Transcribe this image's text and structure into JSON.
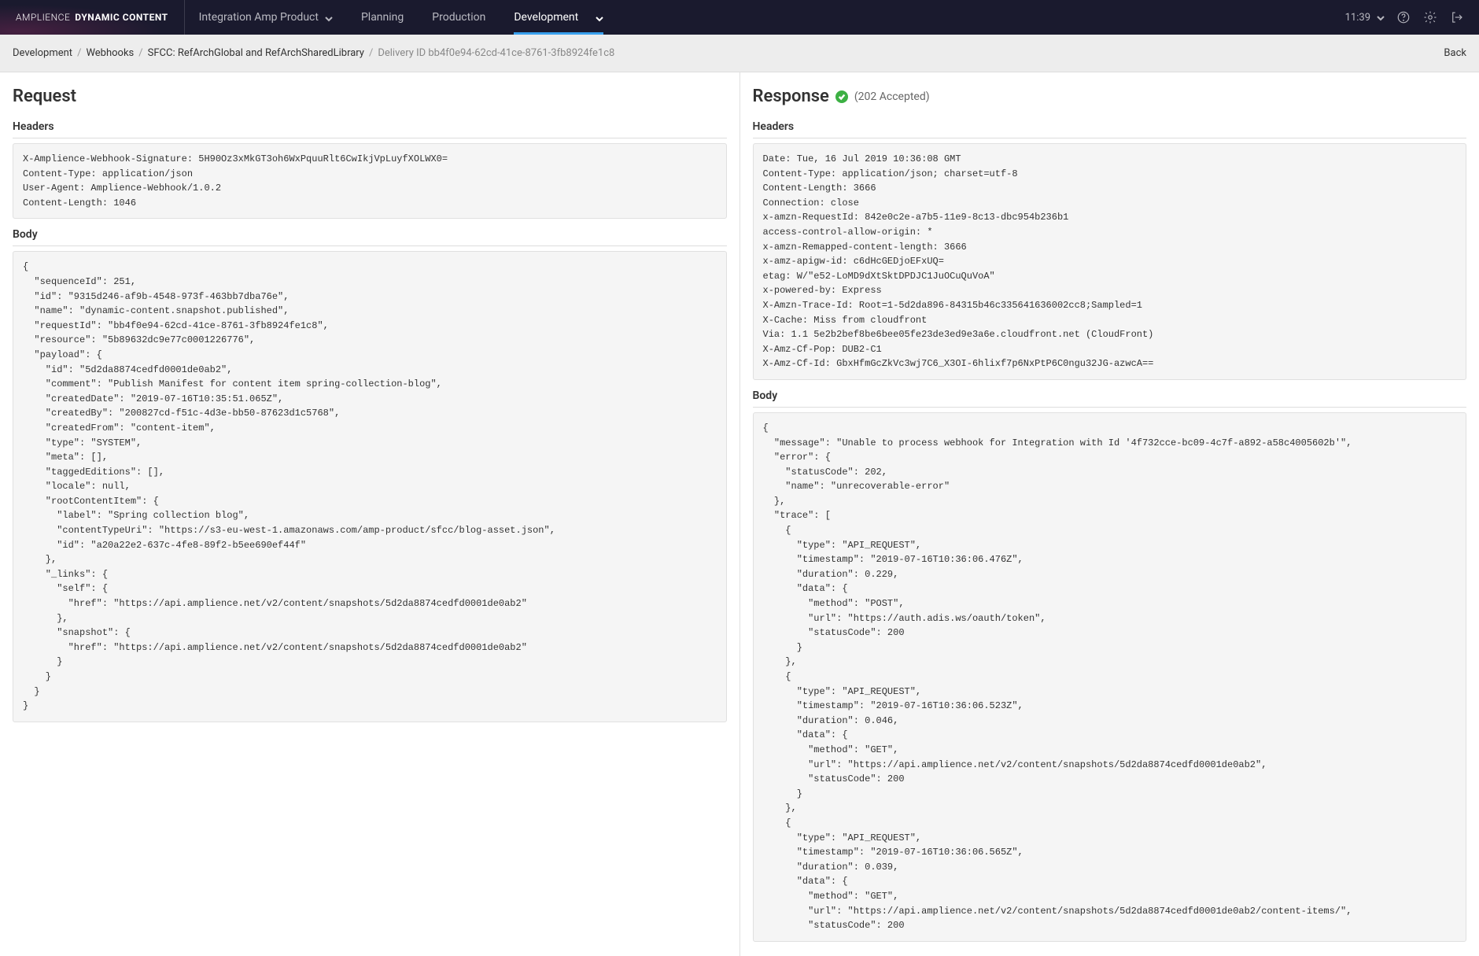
{
  "brand": {
    "part1": "AMPLIENCE",
    "part2": "DYNAMIC CONTENT"
  },
  "nav": {
    "product": "Integration Amp Product",
    "items": [
      "Planning",
      "Production",
      "Development"
    ],
    "active": "Development",
    "time": "11:39"
  },
  "crumbs": {
    "c1": "Development",
    "c2": "Webhooks",
    "c3": "SFCC: RefArchGlobal and RefArchSharedLibrary",
    "c4": "Delivery ID bb4f0e94-62cd-41ce-8761-3fb8924fe1c8",
    "back": "Back"
  },
  "request": {
    "title": "Request",
    "headers_label": "Headers",
    "headers": "X-Amplience-Webhook-Signature: 5H90Oz3xMkGT3oh6WxPquuRlt6CwIkjVpLuyfXOLWX0=\nContent-Type: application/json\nUser-Agent: Amplience-Webhook/1.0.2\nContent-Length: 1046",
    "body_label": "Body",
    "body": "{\n  \"sequenceId\": 251,\n  \"id\": \"9315d246-af9b-4548-973f-463bb7dba76e\",\n  \"name\": \"dynamic-content.snapshot.published\",\n  \"requestId\": \"bb4f0e94-62cd-41ce-8761-3fb8924fe1c8\",\n  \"resource\": \"5b89632dc9e77c0001226776\",\n  \"payload\": {\n    \"id\": \"5d2da8874cedfd0001de0ab2\",\n    \"comment\": \"Publish Manifest for content item spring-collection-blog\",\n    \"createdDate\": \"2019-07-16T10:35:51.065Z\",\n    \"createdBy\": \"200827cd-f51c-4d3e-bb50-87623d1c5768\",\n    \"createdFrom\": \"content-item\",\n    \"type\": \"SYSTEM\",\n    \"meta\": [],\n    \"taggedEditions\": [],\n    \"locale\": null,\n    \"rootContentItem\": {\n      \"label\": \"Spring collection blog\",\n      \"contentTypeUri\": \"https://s3-eu-west-1.amazonaws.com/amp-product/sfcc/blog-asset.json\",\n      \"id\": \"a20a22e2-637c-4fe8-89f2-b5ee690ef44f\"\n    },\n    \"_links\": {\n      \"self\": {\n        \"href\": \"https://api.amplience.net/v2/content/snapshots/5d2da8874cedfd0001de0ab2\"\n      },\n      \"snapshot\": {\n        \"href\": \"https://api.amplience.net/v2/content/snapshots/5d2da8874cedfd0001de0ab2\"\n      }\n    }\n  }\n}"
  },
  "response": {
    "title": "Response",
    "status": "(202 Accepted)",
    "headers_label": "Headers",
    "headers": "Date: Tue, 16 Jul 2019 10:36:08 GMT\nContent-Type: application/json; charset=utf-8\nContent-Length: 3666\nConnection: close\nx-amzn-RequestId: 842e0c2e-a7b5-11e9-8c13-dbc954b236b1\naccess-control-allow-origin: *\nx-amzn-Remapped-content-length: 3666\nx-amz-apigw-id: c6dHcGEDjoEFxUQ=\netag: W/\"e52-LoMD9dXtSktDPDJC1JuOCuQuVoA\"\nx-powered-by: Express\nX-Amzn-Trace-Id: Root=1-5d2da896-84315b46c335641636002cc8;Sampled=1\nX-Cache: Miss from cloudfront\nVia: 1.1 5e2b2bef8be6bee05fe23de3ed9e3a6e.cloudfront.net (CloudFront)\nX-Amz-Cf-Pop: DUB2-C1\nX-Amz-Cf-Id: GbxHfmGcZkVc3wj7C6_X3OI-6hlixf7p6NxPtP6C0ngu32JG-azwcA==",
    "body_label": "Body",
    "body": "{\n  \"message\": \"Unable to process webhook for Integration with Id '4f732cce-bc09-4c7f-a892-a58c4005602b'\",\n  \"error\": {\n    \"statusCode\": 202,\n    \"name\": \"unrecoverable-error\"\n  },\n  \"trace\": [\n    {\n      \"type\": \"API_REQUEST\",\n      \"timestamp\": \"2019-07-16T10:36:06.476Z\",\n      \"duration\": 0.229,\n      \"data\": {\n        \"method\": \"POST\",\n        \"url\": \"https://auth.adis.ws/oauth/token\",\n        \"statusCode\": 200\n      }\n    },\n    {\n      \"type\": \"API_REQUEST\",\n      \"timestamp\": \"2019-07-16T10:36:06.523Z\",\n      \"duration\": 0.046,\n      \"data\": {\n        \"method\": \"GET\",\n        \"url\": \"https://api.amplience.net/v2/content/snapshots/5d2da8874cedfd0001de0ab2\",\n        \"statusCode\": 200\n      }\n    },\n    {\n      \"type\": \"API_REQUEST\",\n      \"timestamp\": \"2019-07-16T10:36:06.565Z\",\n      \"duration\": 0.039,\n      \"data\": {\n        \"method\": \"GET\",\n        \"url\": \"https://api.amplience.net/v2/content/snapshots/5d2da8874cedfd0001de0ab2/content-items/\",\n        \"statusCode\": 200"
  }
}
